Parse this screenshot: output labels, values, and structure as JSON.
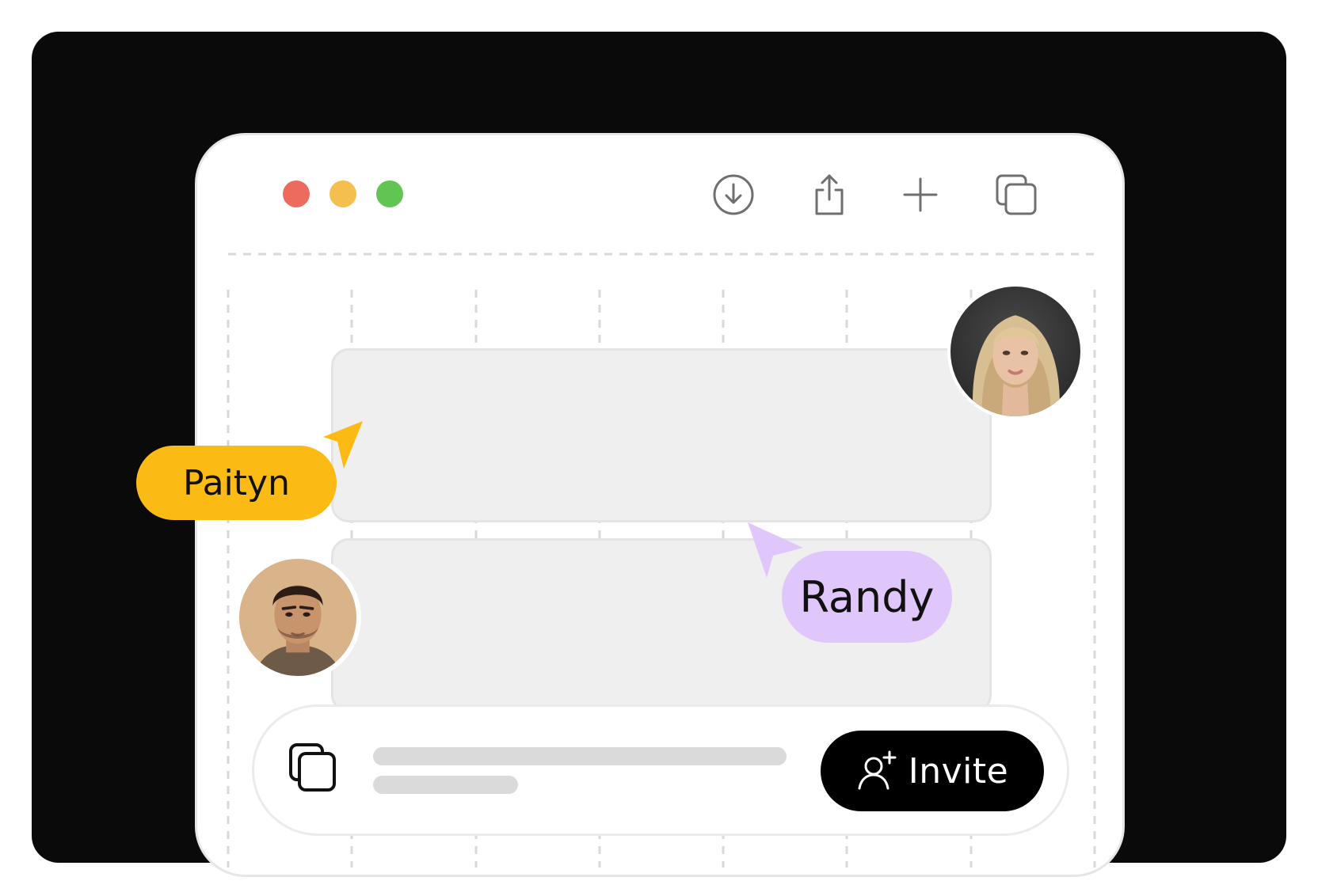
{
  "window": {
    "traffic_lights": [
      {
        "name": "close",
        "color": "#ec6a5e"
      },
      {
        "name": "minimize",
        "color": "#f4bf4f"
      },
      {
        "name": "zoom",
        "color": "#61c554"
      }
    ],
    "toolbar_icons": [
      "download-icon",
      "share-icon",
      "plus-icon",
      "tabs-icon"
    ]
  },
  "collaborators": [
    {
      "name": "Paityn",
      "color": "#fbba14",
      "icon": "cursor-pointer-icon"
    },
    {
      "name": "Randy",
      "color": "#e0c7fb",
      "icon": "cursor-pointer-icon"
    }
  ],
  "avatars": [
    {
      "role": "collaborator-avatar"
    },
    {
      "role": "collaborator-avatar"
    }
  ],
  "bottom_bar": {
    "copy_icon": "copy-icon",
    "invite_label": "Invite",
    "invite_icon": "user-plus-icon"
  }
}
